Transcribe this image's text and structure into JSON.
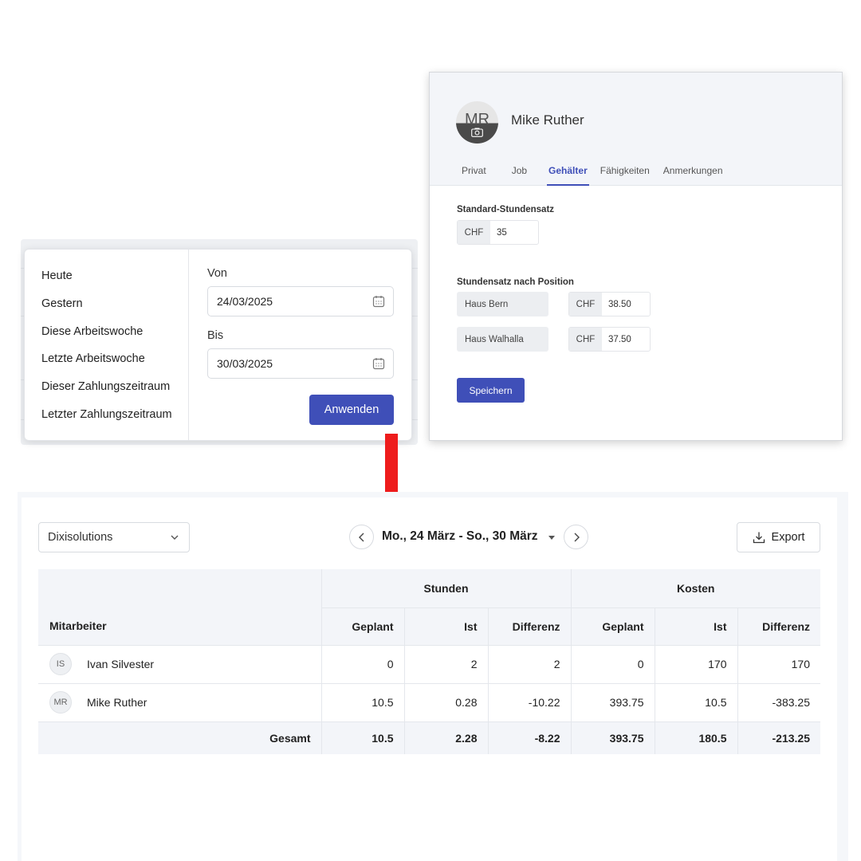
{
  "date_popup": {
    "presets": [
      "Heute",
      "Gestern",
      "Diese Arbeitswoche",
      "Letzte Arbeitswoche",
      "Dieser Zahlungszeitraum",
      "Letzter Zahlungszeitraum"
    ],
    "from_label": "Von",
    "from_value": "24/03/2025",
    "to_label": "Bis",
    "to_value": "30/03/2025",
    "apply_label": "Anwenden"
  },
  "profile": {
    "initials": "MR",
    "name": "Mike Ruther",
    "tabs": [
      "Privat",
      "Job",
      "Gehälter",
      "Fähigkeiten",
      "Anmerkungen"
    ],
    "active_tab": "Gehälter",
    "standard_rate_title": "Standard-Stundensatz",
    "currency": "CHF",
    "standard_rate": "35",
    "position_rate_title": "Stundensatz nach Position",
    "positions": [
      {
        "name": "Haus Bern",
        "rate": "38.50"
      },
      {
        "name": "Haus Walhalla",
        "rate": "37.50"
      }
    ],
    "save_label": "Speichern"
  },
  "report": {
    "company": "Dixisolutions",
    "range": "Mo., 24 März - So., 30 März",
    "export_label": "Export",
    "group_hours": "Stunden",
    "group_costs": "Kosten",
    "col_employee": "Mitarbeiter",
    "col_planned": "Geplant",
    "col_actual": "Ist",
    "col_diff": "Differenz",
    "rows": [
      {
        "initials": "IS",
        "name": "Ivan Silvester",
        "h_planned": "0",
        "h_actual": "2",
        "h_diff": "2",
        "c_planned": "0",
        "c_actual": "170",
        "c_diff": "170"
      },
      {
        "initials": "MR",
        "name": "Mike Ruther",
        "h_planned": "10.5",
        "h_actual": "0.28",
        "h_diff": "-10.22",
        "c_planned": "393.75",
        "c_actual": "10.5",
        "c_diff": "-383.25"
      }
    ],
    "total": {
      "label": "Gesamt",
      "h_planned": "10.5",
      "h_actual": "2.28",
      "h_diff": "-8.22",
      "c_planned": "393.75",
      "c_actual": "180.5",
      "c_diff": "-213.25"
    }
  },
  "colors": {
    "accent": "#3f4fb8",
    "arrow": "#ee1c1c"
  }
}
